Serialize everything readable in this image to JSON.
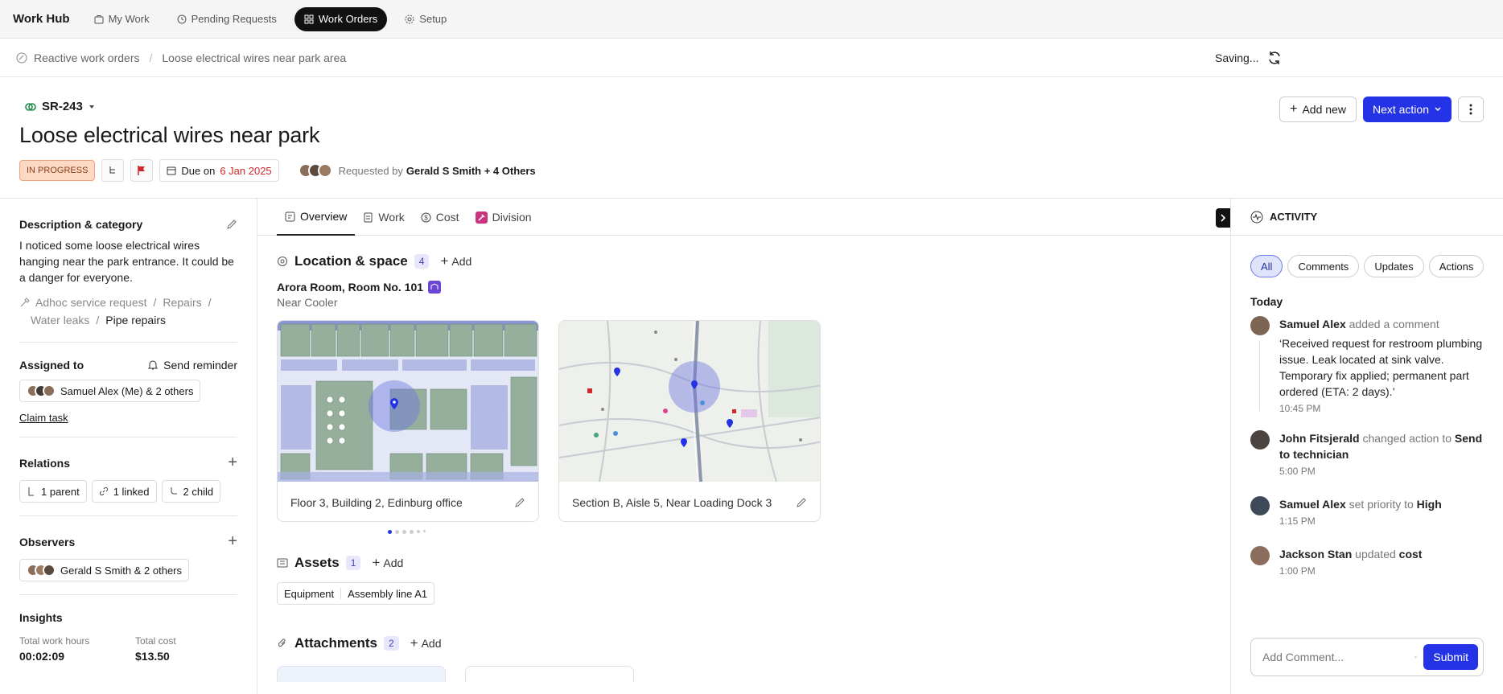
{
  "topbar": {
    "brand": "Work Hub",
    "nav": [
      {
        "label": "My Work",
        "icon": "briefcase-icon"
      },
      {
        "label": "Pending Requests",
        "icon": "clock-icon"
      },
      {
        "label": "Work Orders",
        "icon": "grid-icon",
        "active": true
      },
      {
        "label": "Setup",
        "icon": "gear-icon"
      }
    ]
  },
  "breadcrumb": {
    "items": [
      "Reactive work orders",
      "Loose electrical wires near park area"
    ],
    "status": "Saving..."
  },
  "header": {
    "id": "SR-243",
    "title": "Loose electrical wires near park",
    "status": "IN PROGRESS",
    "due_prefix": "Due on",
    "due_date": "6 Jan 2025",
    "requested_prefix": "Requested by",
    "requested_by": "Gerald S Smith + 4 Others",
    "add_new": "Add new",
    "next_action": "Next action"
  },
  "left": {
    "description_title": "Description & category",
    "description": "I noticed some loose electrical wires hanging near the park entrance. It could be a danger for everyone.",
    "categories": [
      "Adhoc service request",
      "Repairs",
      "Water leaks",
      "Pipe repairs"
    ],
    "assigned_title": "Assigned to",
    "send_reminder": "Send reminder",
    "assignees": "Samuel Alex (Me) & 2 others",
    "claim_task": "Claim task",
    "relations_title": "Relations",
    "relations": [
      "1 parent",
      "1 linked",
      "2 child"
    ],
    "observers_title": "Observers",
    "observers": "Gerald S Smith & 2 others",
    "insights_title": "Insights",
    "work_hours_label": "Total work hours",
    "work_hours": "00:02:09",
    "cost_label": "Total cost",
    "cost": "$13.50"
  },
  "tabs": [
    {
      "label": "Overview",
      "icon": "overview-icon",
      "active": true
    },
    {
      "label": "Work",
      "icon": "work-icon"
    },
    {
      "label": "Cost",
      "icon": "cost-icon"
    },
    {
      "label": "Division",
      "icon": "division-icon"
    }
  ],
  "location": {
    "title": "Location & space",
    "count": "4",
    "add": "Add",
    "name": "Arora Room, Room No. 101",
    "sub": "Near Cooler",
    "cards": [
      {
        "label": "Floor 3, Building 2, Edinburg office"
      },
      {
        "label": "Section B, Aisle 5, Near Loading Dock 3"
      }
    ]
  },
  "assets": {
    "title": "Assets",
    "count": "1",
    "add": "Add",
    "chip_type": "Equipment",
    "chip_name": "Assembly line A1"
  },
  "attachments": {
    "title": "Attachments",
    "count": "2",
    "add": "Add"
  },
  "activity": {
    "title": "ACTIVITY",
    "filters": [
      "All",
      "Comments",
      "Updates",
      "Actions"
    ],
    "today": "Today",
    "items": [
      {
        "user": "Samuel Alex",
        "action": "added a comment",
        "quote": "‘Received request for restroom plumbing issue. Leak located at sink valve. Temporary fix applied; permanent part ordered (ETA: 2 days).’",
        "time": "10:45 PM"
      },
      {
        "user": "John Fitsjerald",
        "action": "changed action to",
        "value": "Send to technician",
        "time": "5:00 PM"
      },
      {
        "user": "Samuel Alex",
        "action": "set priority to",
        "value": "High",
        "time": "1:15 PM"
      },
      {
        "user": "Jackson Stan",
        "action": "updated",
        "value": "cost",
        "time": "1:00 PM"
      }
    ],
    "comment_placeholder": "Add Comment...",
    "submit": "Submit"
  },
  "colors": {
    "primary": "#2433e6",
    "danger": "#d0282c",
    "status_bg": "#fcd9c4"
  }
}
